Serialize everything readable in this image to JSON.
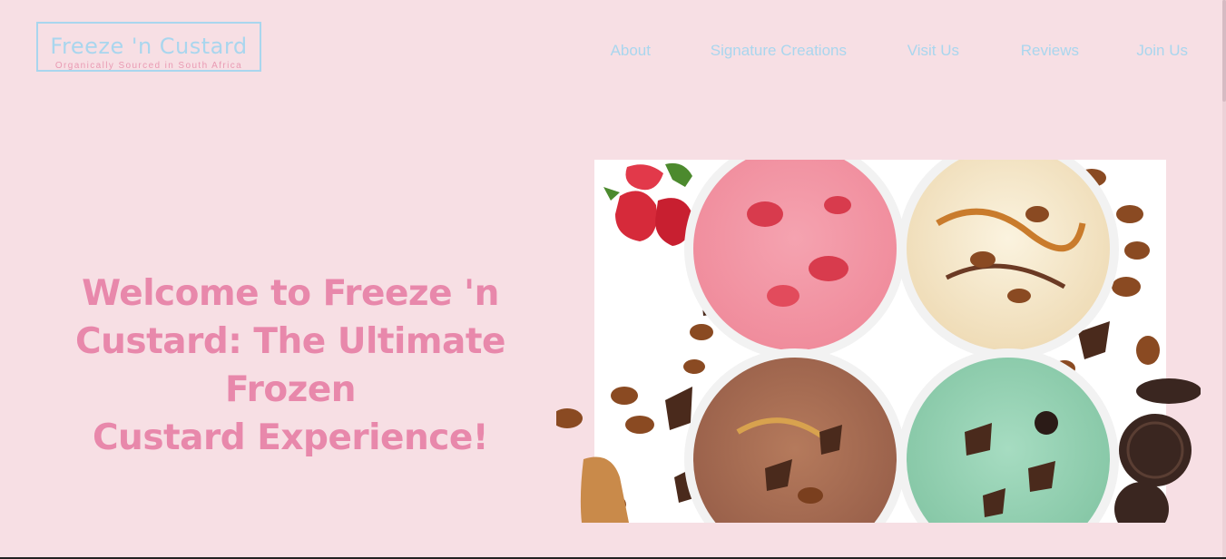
{
  "brand": {
    "name": "Freeze 'n Custard",
    "tagline": "Organically Sourced in South Africa"
  },
  "nav": {
    "items": [
      {
        "label": "About"
      },
      {
        "label": "Signature Creations"
      },
      {
        "label": "Visit Us"
      },
      {
        "label": "Reviews"
      },
      {
        "label": "Join Us"
      }
    ]
  },
  "hero": {
    "title_line1": "Welcome to Freeze 'n",
    "title_line2": "Custard: The Ultimate Frozen",
    "title_line3": "Custard Experience!",
    "image_icon": "custard-cups-photo"
  },
  "colors": {
    "background": "#f7dfe4",
    "accent_blue": "#a9d6ee",
    "accent_pink": "#e888ab"
  }
}
